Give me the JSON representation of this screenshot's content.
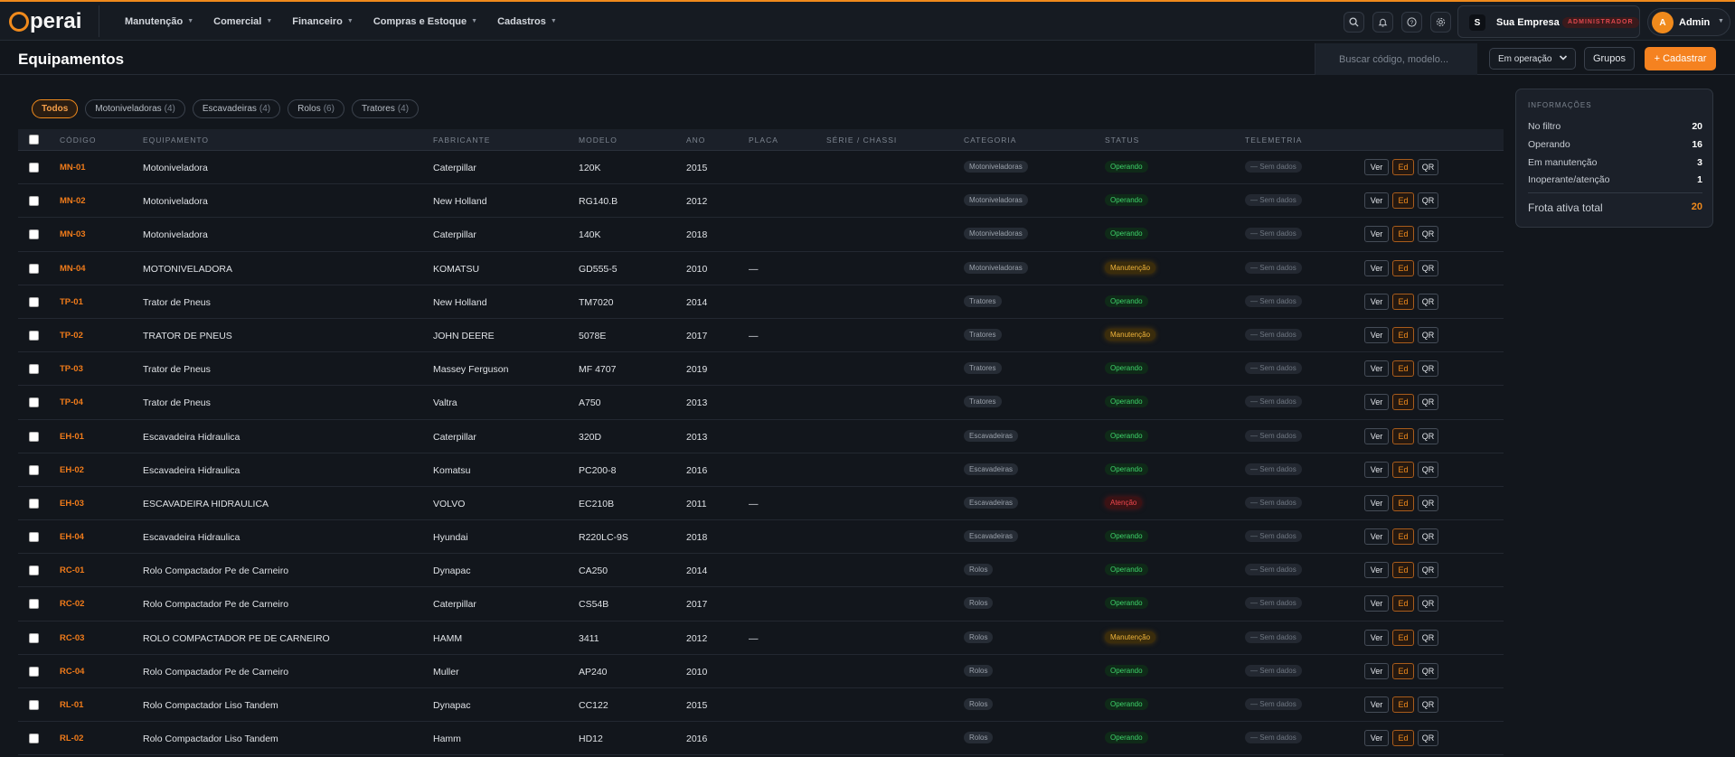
{
  "brand": {
    "logo_text": "perai",
    "accent": "#f08a1c"
  },
  "nav": {
    "items": [
      {
        "label": "Manutenção"
      },
      {
        "label": "Comercial"
      },
      {
        "label": "Financeiro"
      },
      {
        "label": "Compras e Estoque"
      },
      {
        "label": "Cadastros"
      }
    ]
  },
  "topbar": {
    "icons": [
      "search-icon",
      "bell-icon",
      "help-icon",
      "gear-icon"
    ],
    "company": {
      "initial": "S",
      "name": "Sua Empresa",
      "role": "ADMINISTRADOR"
    },
    "user": {
      "initial": "A",
      "name": "Admin"
    }
  },
  "header": {
    "title": "Equipamentos",
    "search_placeholder": "Buscar código, modelo...",
    "status_filter": "Em operação",
    "groups_label": "Grupos",
    "add_label": "+ Cadastrar"
  },
  "filters": [
    {
      "label": "Todos",
      "count": "",
      "active": true
    },
    {
      "label": "Motoniveladoras",
      "count": "(4)",
      "active": false
    },
    {
      "label": "Escavadeiras",
      "count": "(4)",
      "active": false
    },
    {
      "label": "Rolos",
      "count": "(6)",
      "active": false
    },
    {
      "label": "Tratores",
      "count": "(4)",
      "active": false
    }
  ],
  "table": {
    "columns": [
      "CÓDIGO",
      "EQUIPAMENTO",
      "FABRICANTE",
      "MODELO",
      "ANO",
      "PLACA",
      "SÉRIE / CHASSI",
      "CATEGORIA",
      "STATUS",
      "TELEMETRIA"
    ],
    "actions": {
      "view": "Ver",
      "edit": "Ed",
      "qr": "QR"
    },
    "rows": [
      {
        "code": "MN-01",
        "name": "Motoniveladora",
        "maker": "Caterpillar",
        "model": "120K",
        "year": "2015",
        "plate": "",
        "category": "Motoniveladoras",
        "status": "Operando",
        "status_kind": "ok",
        "telemetry": "— Sem dados"
      },
      {
        "code": "MN-02",
        "name": "Motoniveladora",
        "maker": "New Holland",
        "model": "RG140.B",
        "year": "2012",
        "plate": "",
        "category": "Motoniveladoras",
        "status": "Operando",
        "status_kind": "ok",
        "telemetry": "— Sem dados"
      },
      {
        "code": "MN-03",
        "name": "Motoniveladora",
        "maker": "Caterpillar",
        "model": "140K",
        "year": "2018",
        "plate": "",
        "category": "Motoniveladoras",
        "status": "Operando",
        "status_kind": "ok",
        "telemetry": "— Sem dados"
      },
      {
        "code": "MN-04",
        "name": "MOTONIVELADORA",
        "maker": "KOMATSU",
        "model": "GD555-5",
        "year": "2010",
        "plate": "—",
        "category": "Motoniveladoras",
        "status": "Manutenção",
        "status_kind": "mn",
        "telemetry": "— Sem dados"
      },
      {
        "code": "TP-01",
        "name": "Trator de Pneus",
        "maker": "New Holland",
        "model": "TM7020",
        "year": "2014",
        "plate": "",
        "category": "Tratores",
        "status": "Operando",
        "status_kind": "ok",
        "telemetry": "— Sem dados"
      },
      {
        "code": "TP-02",
        "name": "TRATOR DE PNEUS",
        "maker": "JOHN DEERE",
        "model": "5078E",
        "year": "2017",
        "plate": "—",
        "category": "Tratores",
        "status": "Manutenção",
        "status_kind": "mn",
        "telemetry": "— Sem dados"
      },
      {
        "code": "TP-03",
        "name": "Trator de Pneus",
        "maker": "Massey Ferguson",
        "model": "MF 4707",
        "year": "2019",
        "plate": "",
        "category": "Tratores",
        "status": "Operando",
        "status_kind": "ok",
        "telemetry": "— Sem dados"
      },
      {
        "code": "TP-04",
        "name": "Trator de Pneus",
        "maker": "Valtra",
        "model": "A750",
        "year": "2013",
        "plate": "",
        "category": "Tratores",
        "status": "Operando",
        "status_kind": "ok",
        "telemetry": "— Sem dados"
      },
      {
        "code": "EH-01",
        "name": "Escavadeira Hidraulica",
        "maker": "Caterpillar",
        "model": "320D",
        "year": "2013",
        "plate": "",
        "category": "Escavadeiras",
        "status": "Operando",
        "status_kind": "ok",
        "telemetry": "— Sem dados"
      },
      {
        "code": "EH-02",
        "name": "Escavadeira Hidraulica",
        "maker": "Komatsu",
        "model": "PC200-8",
        "year": "2016",
        "plate": "",
        "category": "Escavadeiras",
        "status": "Operando",
        "status_kind": "ok",
        "telemetry": "— Sem dados"
      },
      {
        "code": "EH-03",
        "name": "ESCAVADEIRA HIDRAULICA",
        "maker": "VOLVO",
        "model": "EC210B",
        "year": "2011",
        "plate": "—",
        "category": "Escavadeiras",
        "status": "Atenção",
        "status_kind": "at",
        "telemetry": "— Sem dados"
      },
      {
        "code": "EH-04",
        "name": "Escavadeira Hidraulica",
        "maker": "Hyundai",
        "model": "R220LC-9S",
        "year": "2018",
        "plate": "",
        "category": "Escavadeiras",
        "status": "Operando",
        "status_kind": "ok",
        "telemetry": "— Sem dados"
      },
      {
        "code": "RC-01",
        "name": "Rolo Compactador Pe de Carneiro",
        "maker": "Dynapac",
        "model": "CA250",
        "year": "2014",
        "plate": "",
        "category": "Rolos",
        "status": "Operando",
        "status_kind": "ok",
        "telemetry": "— Sem dados"
      },
      {
        "code": "RC-02",
        "name": "Rolo Compactador Pe de Carneiro",
        "maker": "Caterpillar",
        "model": "CS54B",
        "year": "2017",
        "plate": "",
        "category": "Rolos",
        "status": "Operando",
        "status_kind": "ok",
        "telemetry": "— Sem dados"
      },
      {
        "code": "RC-03",
        "name": "ROLO COMPACTADOR PE DE CARNEIRO",
        "maker": "HAMM",
        "model": "3411",
        "year": "2012",
        "plate": "—",
        "category": "Rolos",
        "status": "Manutenção",
        "status_kind": "mn",
        "telemetry": "— Sem dados"
      },
      {
        "code": "RC-04",
        "name": "Rolo Compactador Pe de Carneiro",
        "maker": "Muller",
        "model": "AP240",
        "year": "2010",
        "plate": "",
        "category": "Rolos",
        "status": "Operando",
        "status_kind": "ok",
        "telemetry": "— Sem dados"
      },
      {
        "code": "RL-01",
        "name": "Rolo Compactador Liso Tandem",
        "maker": "Dynapac",
        "model": "CC122",
        "year": "2015",
        "plate": "",
        "category": "Rolos",
        "status": "Operando",
        "status_kind": "ok",
        "telemetry": "— Sem dados"
      },
      {
        "code": "RL-02",
        "name": "Rolo Compactador Liso Tandem",
        "maker": "Hamm",
        "model": "HD12",
        "year": "2016",
        "plate": "",
        "category": "Rolos",
        "status": "Operando",
        "status_kind": "ok",
        "telemetry": "— Sem dados"
      }
    ]
  },
  "info": {
    "title": "INFORMAÇÕES",
    "rows": [
      {
        "label": "No filtro",
        "value": "20"
      },
      {
        "label": "Operando",
        "value": "16"
      },
      {
        "label": "Em manutenção",
        "value": "3"
      },
      {
        "label": "Inoperante/atenção",
        "value": "1"
      }
    ],
    "total_label": "Frota ativa total",
    "total_value": "20"
  }
}
